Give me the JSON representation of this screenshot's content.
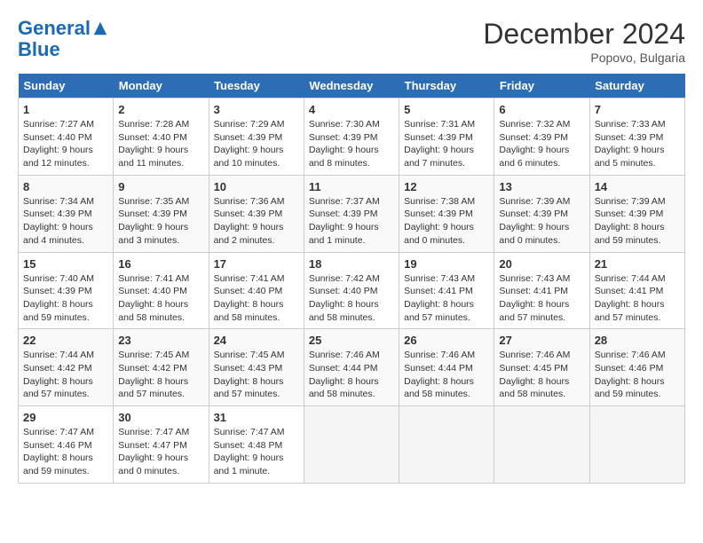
{
  "header": {
    "logo_line1": "General",
    "logo_line2": "Blue",
    "month": "December 2024",
    "location": "Popovo, Bulgaria"
  },
  "days_of_week": [
    "Sunday",
    "Monday",
    "Tuesday",
    "Wednesday",
    "Thursday",
    "Friday",
    "Saturday"
  ],
  "weeks": [
    [
      {
        "day": 1,
        "sunrise": "7:27 AM",
        "sunset": "4:40 PM",
        "daylight": "9 hours and 12 minutes."
      },
      {
        "day": 2,
        "sunrise": "7:28 AM",
        "sunset": "4:40 PM",
        "daylight": "9 hours and 11 minutes."
      },
      {
        "day": 3,
        "sunrise": "7:29 AM",
        "sunset": "4:39 PM",
        "daylight": "9 hours and 10 minutes."
      },
      {
        "day": 4,
        "sunrise": "7:30 AM",
        "sunset": "4:39 PM",
        "daylight": "9 hours and 8 minutes."
      },
      {
        "day": 5,
        "sunrise": "7:31 AM",
        "sunset": "4:39 PM",
        "daylight": "9 hours and 7 minutes."
      },
      {
        "day": 6,
        "sunrise": "7:32 AM",
        "sunset": "4:39 PM",
        "daylight": "9 hours and 6 minutes."
      },
      {
        "day": 7,
        "sunrise": "7:33 AM",
        "sunset": "4:39 PM",
        "daylight": "9 hours and 5 minutes."
      }
    ],
    [
      {
        "day": 8,
        "sunrise": "7:34 AM",
        "sunset": "4:39 PM",
        "daylight": "9 hours and 4 minutes."
      },
      {
        "day": 9,
        "sunrise": "7:35 AM",
        "sunset": "4:39 PM",
        "daylight": "9 hours and 3 minutes."
      },
      {
        "day": 10,
        "sunrise": "7:36 AM",
        "sunset": "4:39 PM",
        "daylight": "9 hours and 2 minutes."
      },
      {
        "day": 11,
        "sunrise": "7:37 AM",
        "sunset": "4:39 PM",
        "daylight": "9 hours and 1 minute."
      },
      {
        "day": 12,
        "sunrise": "7:38 AM",
        "sunset": "4:39 PM",
        "daylight": "9 hours and 0 minutes."
      },
      {
        "day": 13,
        "sunrise": "7:39 AM",
        "sunset": "4:39 PM",
        "daylight": "9 hours and 0 minutes."
      },
      {
        "day": 14,
        "sunrise": "7:39 AM",
        "sunset": "4:39 PM",
        "daylight": "8 hours and 59 minutes."
      }
    ],
    [
      {
        "day": 15,
        "sunrise": "7:40 AM",
        "sunset": "4:39 PM",
        "daylight": "8 hours and 59 minutes."
      },
      {
        "day": 16,
        "sunrise": "7:41 AM",
        "sunset": "4:40 PM",
        "daylight": "8 hours and 58 minutes."
      },
      {
        "day": 17,
        "sunrise": "7:41 AM",
        "sunset": "4:40 PM",
        "daylight": "8 hours and 58 minutes."
      },
      {
        "day": 18,
        "sunrise": "7:42 AM",
        "sunset": "4:40 PM",
        "daylight": "8 hours and 58 minutes."
      },
      {
        "day": 19,
        "sunrise": "7:43 AM",
        "sunset": "4:41 PM",
        "daylight": "8 hours and 57 minutes."
      },
      {
        "day": 20,
        "sunrise": "7:43 AM",
        "sunset": "4:41 PM",
        "daylight": "8 hours and 57 minutes."
      },
      {
        "day": 21,
        "sunrise": "7:44 AM",
        "sunset": "4:41 PM",
        "daylight": "8 hours and 57 minutes."
      }
    ],
    [
      {
        "day": 22,
        "sunrise": "7:44 AM",
        "sunset": "4:42 PM",
        "daylight": "8 hours and 57 minutes."
      },
      {
        "day": 23,
        "sunrise": "7:45 AM",
        "sunset": "4:42 PM",
        "daylight": "8 hours and 57 minutes."
      },
      {
        "day": 24,
        "sunrise": "7:45 AM",
        "sunset": "4:43 PM",
        "daylight": "8 hours and 57 minutes."
      },
      {
        "day": 25,
        "sunrise": "7:46 AM",
        "sunset": "4:44 PM",
        "daylight": "8 hours and 58 minutes."
      },
      {
        "day": 26,
        "sunrise": "7:46 AM",
        "sunset": "4:44 PM",
        "daylight": "8 hours and 58 minutes."
      },
      {
        "day": 27,
        "sunrise": "7:46 AM",
        "sunset": "4:45 PM",
        "daylight": "8 hours and 58 minutes."
      },
      {
        "day": 28,
        "sunrise": "7:46 AM",
        "sunset": "4:46 PM",
        "daylight": "8 hours and 59 minutes."
      }
    ],
    [
      {
        "day": 29,
        "sunrise": "7:47 AM",
        "sunset": "4:46 PM",
        "daylight": "8 hours and 59 minutes."
      },
      {
        "day": 30,
        "sunrise": "7:47 AM",
        "sunset": "4:47 PM",
        "daylight": "9 hours and 0 minutes."
      },
      {
        "day": 31,
        "sunrise": "7:47 AM",
        "sunset": "4:48 PM",
        "daylight": "9 hours and 1 minute."
      },
      null,
      null,
      null,
      null
    ]
  ]
}
